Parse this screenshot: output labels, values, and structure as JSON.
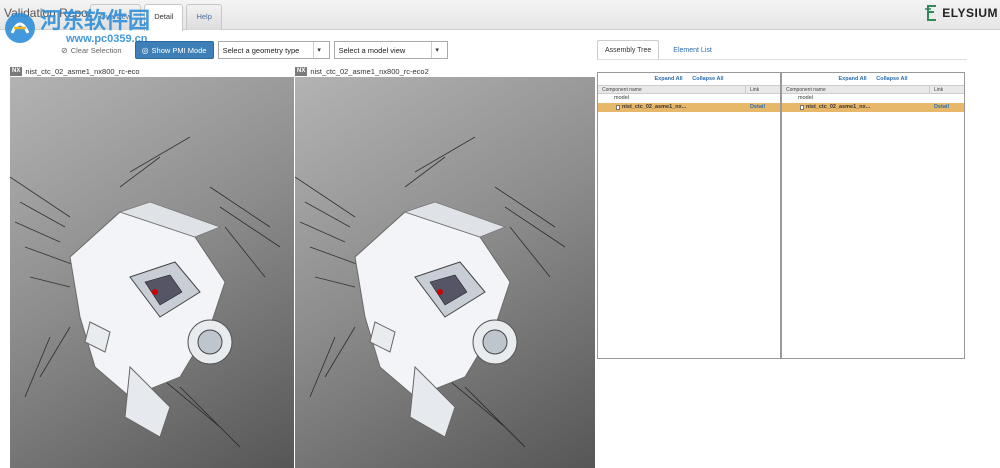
{
  "header": {
    "app_title": "Validation Report",
    "tabs": [
      {
        "label": "Overview",
        "active": false
      },
      {
        "label": "Detail",
        "active": true
      },
      {
        "label": "Help",
        "active": false
      }
    ],
    "brand": "ELYSIUM"
  },
  "toolbar": {
    "clear_selection_label": "Clear Selection",
    "mode_button_label": "Show PMI Mode",
    "geometry_select": {
      "value": "Select a geometry type"
    },
    "model_view_select": {
      "value": "Select a model view"
    }
  },
  "viewers": [
    {
      "badge": "NX",
      "file": "nist_ctc_02_asme1_nx800_rc-eco"
    },
    {
      "badge": "NX",
      "file": "nist_ctc_02_asme1_nx800_rc-eco2"
    }
  ],
  "panel": {
    "tabs": [
      {
        "label": "Assembly Tree",
        "active": true
      },
      {
        "label": "Element List",
        "active": false
      }
    ]
  },
  "trees": [
    {
      "expand_label": "Expand All",
      "collapse_label": "Collapse All",
      "col_name": "Component name",
      "col_link": "Link",
      "root": "model",
      "child": "nist_ctc_02_asme1_nx...",
      "child_link": "Detail"
    },
    {
      "expand_label": "Expand All",
      "collapse_label": "Collapse All",
      "col_name": "Component name",
      "col_link": "Link",
      "root": "model",
      "child": "nist_ctc_02_asme1_nx...",
      "child_link": "Detail"
    }
  ],
  "watermark": {
    "text": "河东软件园",
    "url": "www.pc0359.cn"
  },
  "colors": {
    "accent": "#3f7fb8",
    "link": "#2a6fb0",
    "selected_row": "#e8b86a"
  }
}
